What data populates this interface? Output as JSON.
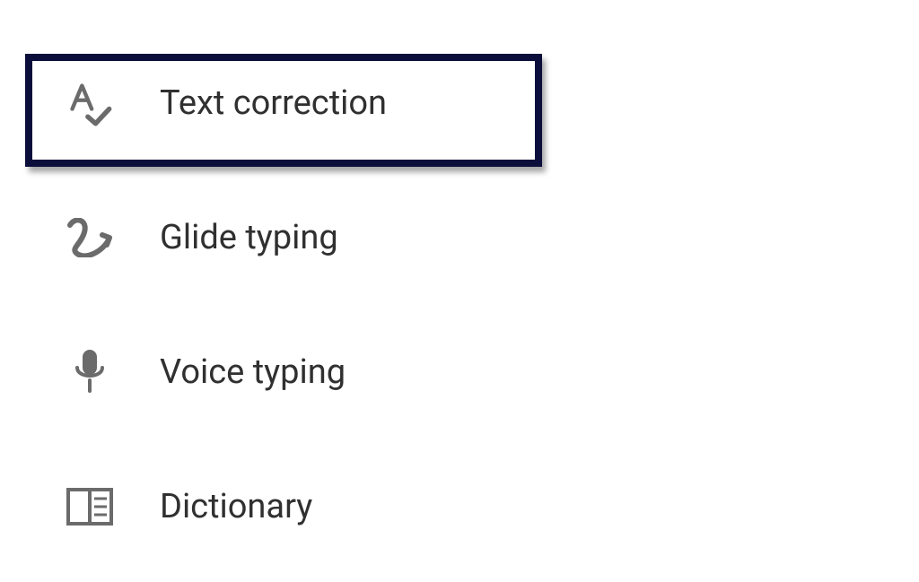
{
  "menu": {
    "items": [
      {
        "label": "Text correction",
        "icon": "text-correction-icon",
        "highlighted": true
      },
      {
        "label": "Glide typing",
        "icon": "glide-typing-icon",
        "highlighted": false
      },
      {
        "label": "Voice typing",
        "icon": "voice-typing-icon",
        "highlighted": false
      },
      {
        "label": "Dictionary",
        "icon": "dictionary-icon",
        "highlighted": false
      }
    ]
  },
  "colors": {
    "highlight": "#0b0d3a",
    "icon": "#6b6b6b",
    "text": "#303030"
  }
}
